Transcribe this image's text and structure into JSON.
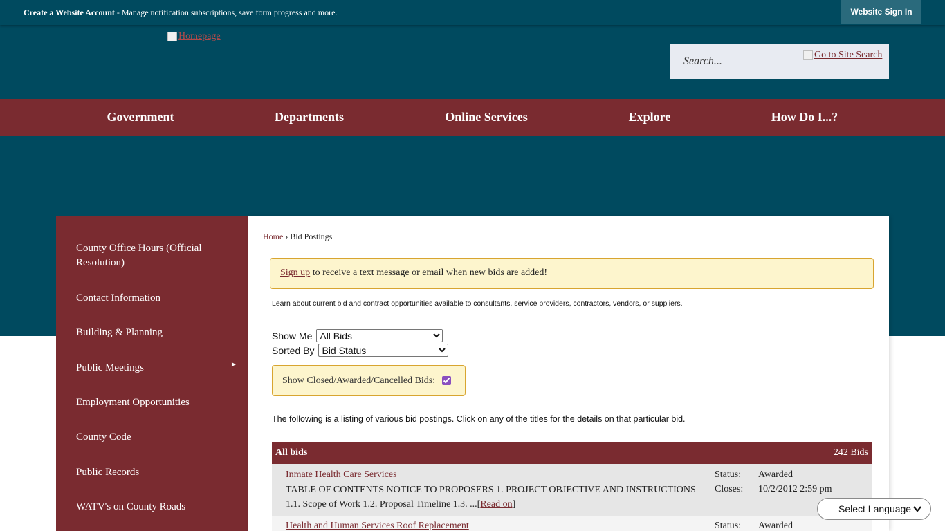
{
  "topbar": {
    "create_account": "Create a Website Account",
    "tagline": " - Manage notification subscriptions, save form progress and more.",
    "signin": "Website Sign In"
  },
  "header": {
    "logo_alt": "Homepage",
    "search_placeholder": "Search...",
    "search_button_alt": "Go to Site Search"
  },
  "nav": [
    {
      "label": "Government"
    },
    {
      "label": "Departments"
    },
    {
      "label": "Online Services"
    },
    {
      "label": "Explore"
    },
    {
      "label": "How Do I...?"
    }
  ],
  "sidebar": [
    {
      "label": "County Office Hours (Official Resolution)"
    },
    {
      "label": "Contact Information"
    },
    {
      "label": "Building & Planning"
    },
    {
      "label": "Public Meetings",
      "has_submenu": true
    },
    {
      "label": "Employment Opportunities"
    },
    {
      "label": "County Code"
    },
    {
      "label": "Public Records"
    },
    {
      "label": "WATV's on County Roads"
    }
  ],
  "breadcrumb": {
    "home": "Home",
    "separator": " › ",
    "current": "Bid Postings"
  },
  "alert": {
    "link": "Sign up",
    "text": " to receive a text message or email when new bids are added!"
  },
  "intro": "Learn about current bid and contract opportunities available to consultants, service providers, contractors, vendors, or suppliers.",
  "filters": {
    "show_me_label": "Show Me",
    "show_me_value": "All Bids",
    "sorted_by_label": "Sorted By",
    "sorted_by_value": "Bid Status",
    "closed_label": "Show Closed/Awarded/Cancelled Bids:",
    "closed_checked": true
  },
  "listing_intro": "The following is a listing of various bid postings. Click on any of the titles for the details on that particular bid.",
  "bids": {
    "header": "All bids",
    "count": "242 Bids",
    "items": [
      {
        "title": "Inmate Health Care Services",
        "desc": "TABLE OF CONTENTS NOTICE TO PROPOSERS 1. PROJECT OBJECTIVE AND INSTRUCTIONS 1.1. Scope of Work 1.2. Proposal Timeline 1.3. ...",
        "read_on": "Read on",
        "status_label": "Status:",
        "status": "Awarded",
        "closes_label": "Closes:",
        "closes": "10/2/2012 2:59 pm"
      },
      {
        "title": "Health and Human Services Roof Replacement",
        "status_label": "Status:",
        "status": "Awarded"
      }
    ]
  },
  "language": {
    "label": "Select Language"
  },
  "colors": {
    "teal": "#004a5f",
    "maroon": "#7a2b30",
    "alert_bg": "#fdf5cd",
    "alert_border": "#d8a530"
  }
}
